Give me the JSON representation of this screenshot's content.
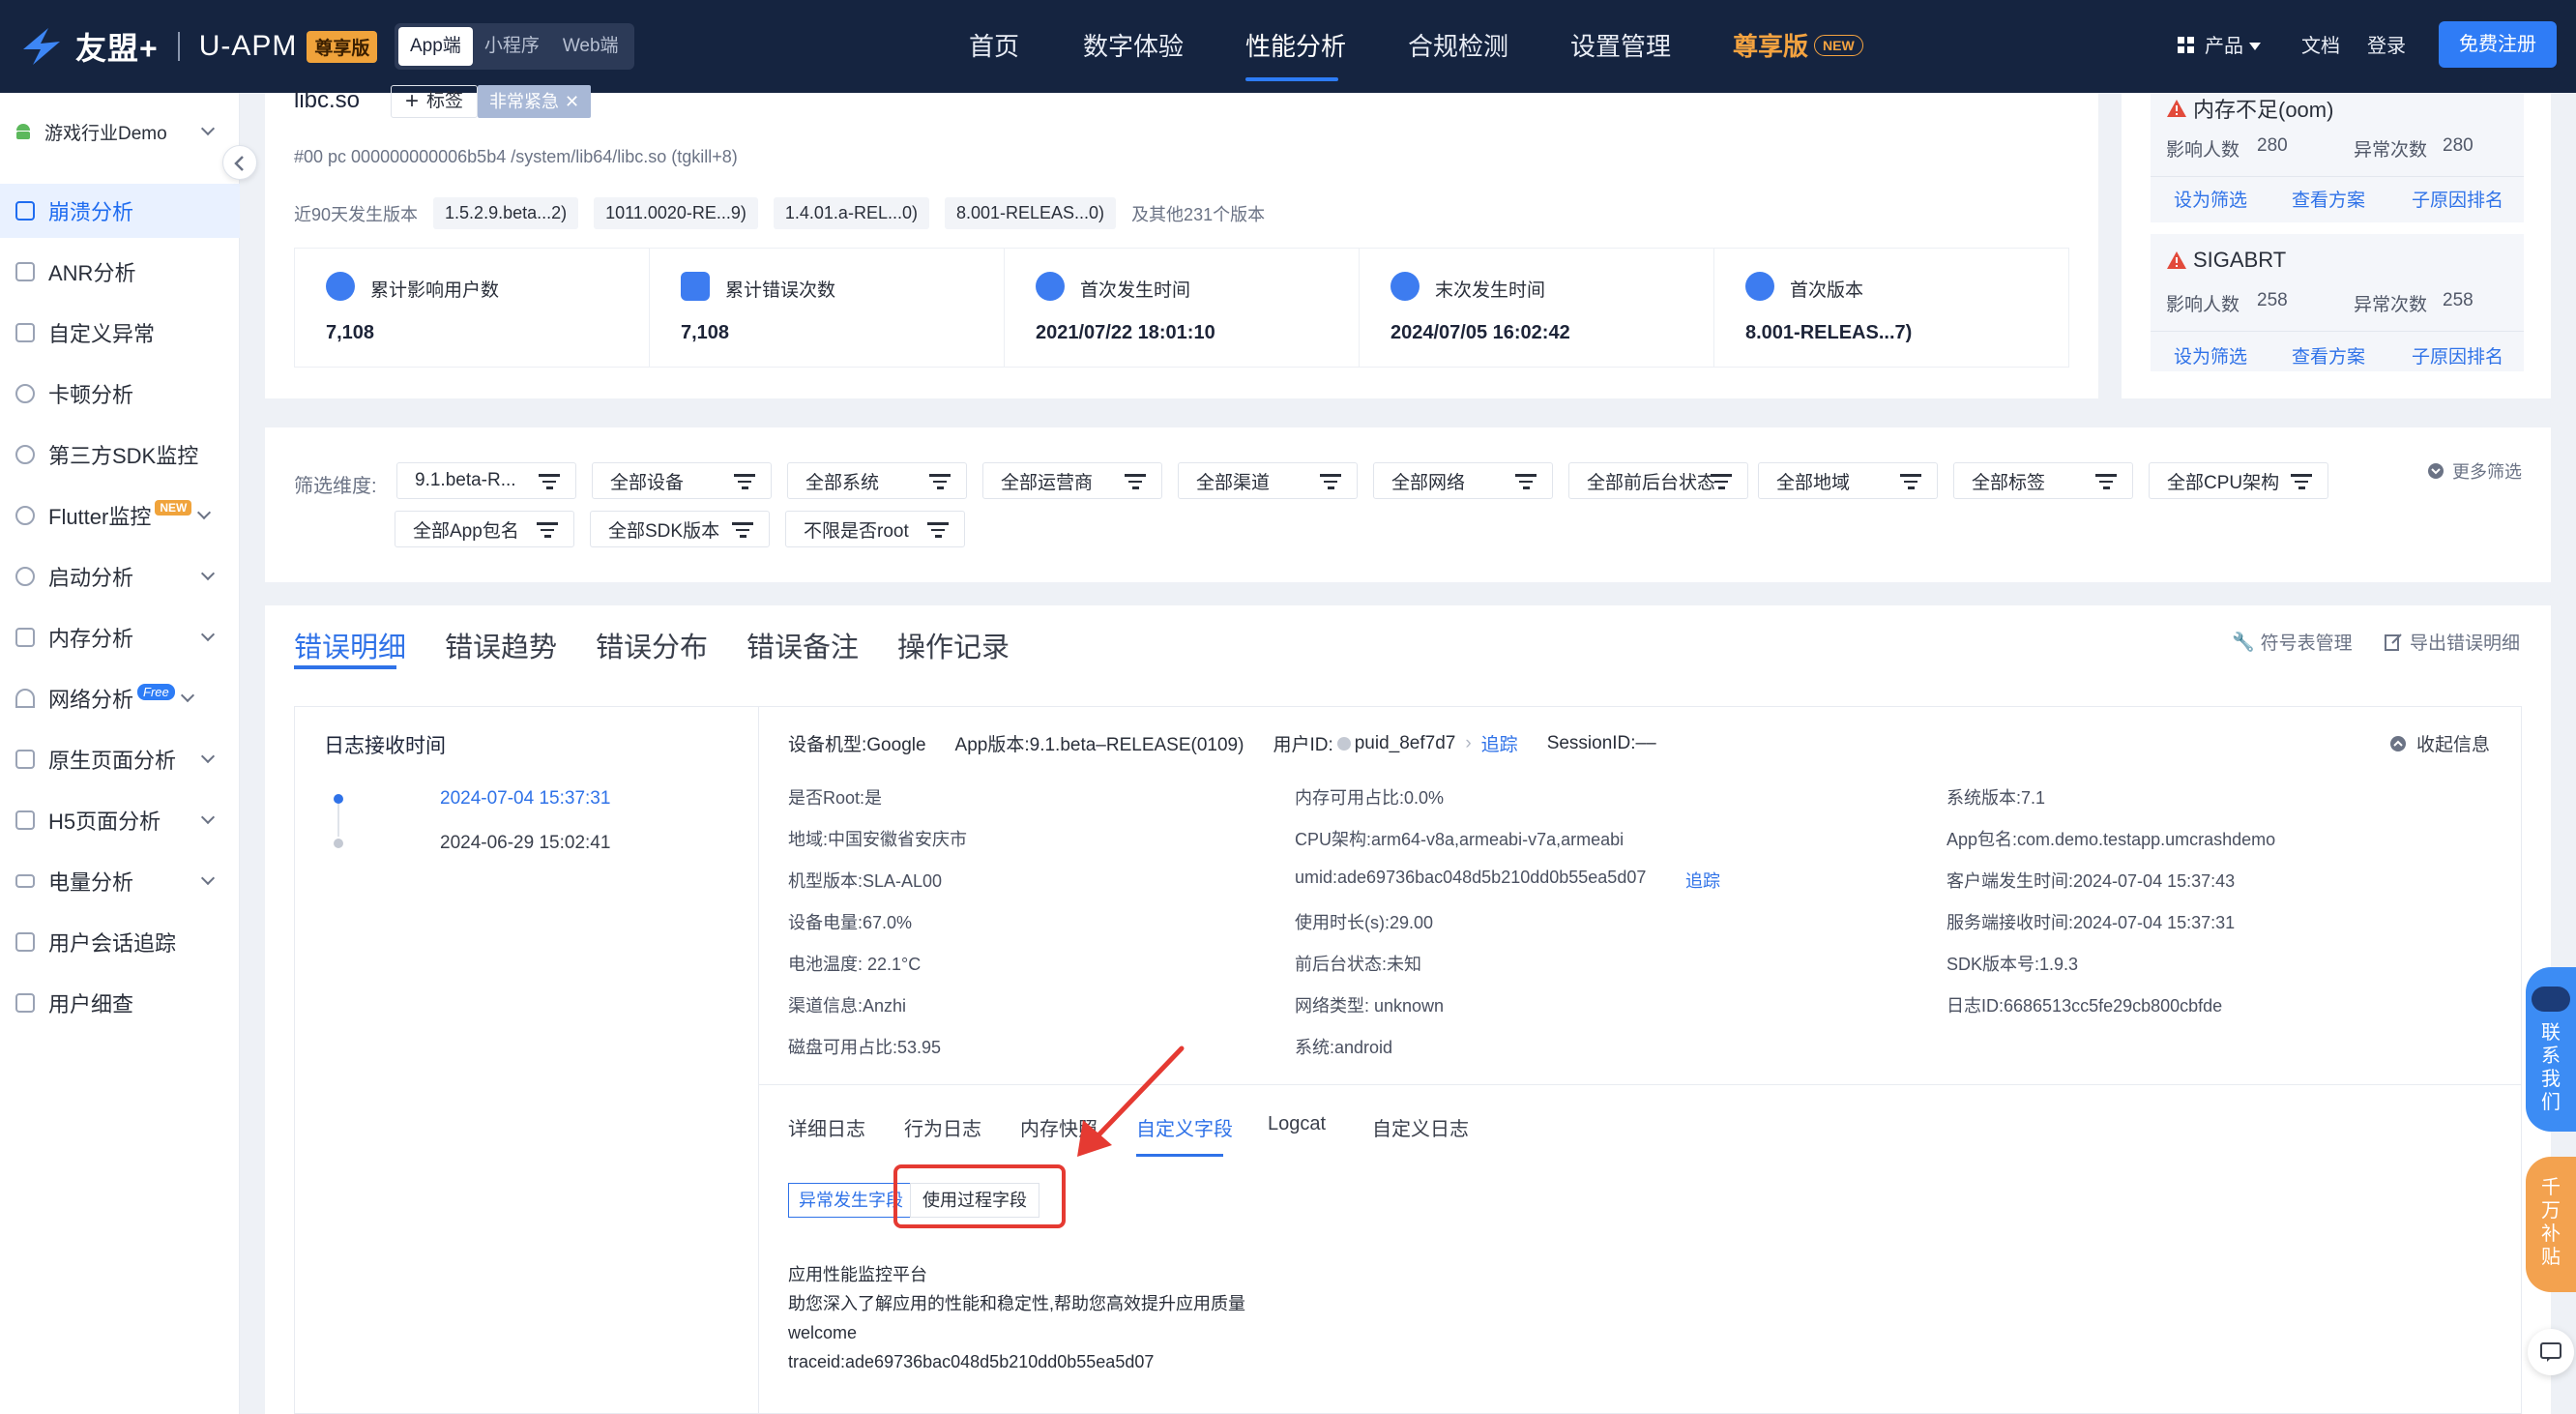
{
  "nav": {
    "logo_cn": "友盟+",
    "logo_product": "U-APM",
    "logo_badge": "尊享版",
    "platform_tabs": [
      "App端",
      "小程序",
      "Web端"
    ],
    "menu": [
      "首页",
      "数字体验",
      "性能分析",
      "合规检测",
      "设置管理",
      "尊享版"
    ],
    "new_badge": "NEW",
    "product": "产品",
    "docs": "文档",
    "login": "登录",
    "register": "免费注册"
  },
  "sidebar": {
    "app_name": "游戏行业Demo",
    "items": [
      {
        "label": "崩溃分析"
      },
      {
        "label": "ANR分析"
      },
      {
        "label": "自定义异常"
      },
      {
        "label": "卡顿分析"
      },
      {
        "label": "第三方SDK监控"
      },
      {
        "label": "Flutter监控",
        "tag": "NEW"
      },
      {
        "label": "启动分析"
      },
      {
        "label": "内存分析"
      },
      {
        "label": "网络分析",
        "tag": "Free"
      },
      {
        "label": "原生页面分析"
      },
      {
        "label": "H5页面分析"
      },
      {
        "label": "电量分析"
      },
      {
        "label": "用户会话追踪"
      },
      {
        "label": "用户细查"
      }
    ]
  },
  "error": {
    "lib": "libc.so",
    "tag_button": "标签",
    "urgency_tag": "非常紧急",
    "stack": "#00 pc 000000000006b5b4 /system/lib64/libc.so (tgkill+8)",
    "versions_label": "近90天发生版本",
    "versions": [
      "1.5.2.9.beta...2)",
      "1011.0020-RE...9)",
      "1.4.01.a-REL...0)",
      "8.001-RELEAS...0)"
    ],
    "more_versions": "及其他231个版本",
    "stats": [
      {
        "label": "累计影响用户数",
        "value": "7,108"
      },
      {
        "label": "累计错误次数",
        "value": "7,108"
      },
      {
        "label": "首次发生时间",
        "value": "2021/07/22 18:01:10"
      },
      {
        "label": "末次发生时间",
        "value": "2024/07/05 16:02:42"
      },
      {
        "label": "首次版本",
        "value": "8.001-RELEAS...7)"
      }
    ]
  },
  "side_cards": [
    {
      "title": "内存不足(oom)",
      "users_label": "影响人数",
      "users": "280",
      "count_label": "异常次数",
      "count": "280",
      "actions": [
        "设为筛选",
        "查看方案",
        "子原因排名"
      ]
    },
    {
      "title": "SIGABRT",
      "users_label": "影响人数",
      "users": "258",
      "count_label": "异常次数",
      "count": "258",
      "actions": [
        "设为筛选",
        "查看方案",
        "子原因排名"
      ]
    }
  ],
  "filters": {
    "label": "筛选维度:",
    "row1": [
      "9.1.beta-R...",
      "全部设备",
      "全部系统",
      "全部运营商",
      "全部渠道",
      "全部网络",
      "全部前后台状态",
      "全部地域",
      "全部标签",
      "全部CPU架构"
    ],
    "row2": [
      "全部App包名",
      "全部SDK版本",
      "不限是否root"
    ],
    "more": "更多筛选"
  },
  "tabs": [
    "错误明细",
    "错误趋势",
    "错误分布",
    "错误备注",
    "操作记录"
  ],
  "tab_actions": [
    "符号表管理",
    "导出错误明细"
  ],
  "detail": {
    "log_time_title": "日志接收时间",
    "timeline": [
      "2024-07-04 15:37:31",
      "2024-06-29 15:02:41"
    ],
    "header": {
      "device": "设备机型:Google",
      "app_version": "App版本:9.1.beta–RELEASE(0109)",
      "user_id_label": "用户ID:",
      "user_id": "puid_8ef7d7",
      "trace": "追踪",
      "session": "SessionID:––",
      "collapse": "收起信息"
    },
    "col1": [
      "是否Root:是",
      "地域:中国安徽省安庆市",
      "机型版本:SLA-AL00",
      "设备电量:67.0%",
      "电池温度: 22.1°C",
      "渠道信息:Anzhi",
      "磁盘可用占比:53.95"
    ],
    "col2": [
      "内存可用占比:0.0%",
      "CPU架构:arm64-v8a,armeabi-v7a,armeabi",
      "umid:ade69736bac048d5b210dd0b55ea5d07",
      "使用时长(s):29.00",
      "前后台状态:未知",
      "网络类型: unknown",
      "系统:android"
    ],
    "umid_trace": "追踪",
    "col3": [
      "系统版本:7.1",
      "App包名:com.demo.testapp.umcrashdemo",
      "客户端发生时间:2024-07-04 15:37:43",
      "服务端接收时间:2024-07-04 15:37:31",
      "SDK版本号:1.9.3",
      "日志ID:6686513cc5fe29cb800cbfde"
    ],
    "subtabs": [
      "详细日志",
      "行为日志",
      "内存快照",
      "自定义字段",
      "Logcat",
      "自定义日志"
    ],
    "segments": [
      "异常发生字段",
      "使用过程字段"
    ],
    "content": [
      "应用性能监控平台",
      "助您深入了解应用的性能和稳定性,帮助您高效提升应用质量",
      "welcome",
      "traceid:ade69736bac048d5b210dd0b55ea5d07"
    ]
  },
  "float": {
    "contact": [
      "联",
      "系",
      "我",
      "们"
    ],
    "subsidy": [
      "千",
      "万",
      "补",
      "贴"
    ]
  },
  "colors": {
    "nav_bg": "#152440",
    "accent": "#2f72e8",
    "gold": "#f4a340",
    "highlight": "#e53a32"
  }
}
